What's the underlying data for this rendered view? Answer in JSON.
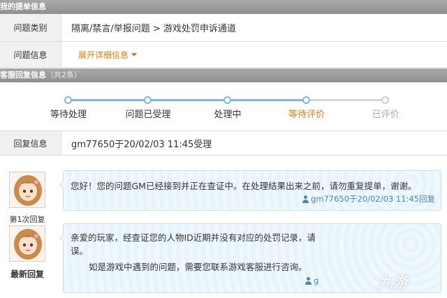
{
  "ticket_section": {
    "title": "我的提单信息"
  },
  "ticket": {
    "category_label": "问题类别",
    "category_value": "隔离/禁言/举报问题 > 游戏处罚申诉通道",
    "info_label": "问题信息",
    "expand_link": "展开详细信息"
  },
  "reply_section": {
    "title": "客服回复信息",
    "count": "（共2条）"
  },
  "progress": {
    "steps": [
      {
        "label": "等待处理",
        "state": "done"
      },
      {
        "label": "问题已受理",
        "state": "done"
      },
      {
        "label": "处理中",
        "state": "done"
      },
      {
        "label": "等待评价",
        "state": "current"
      },
      {
        "label": "已评价",
        "state": "pending"
      }
    ]
  },
  "reply_info": {
    "label": "回复信息",
    "value": "gm77650于20/02/03 11:45受理"
  },
  "messages": [
    {
      "caption": "第1次回复",
      "text": "您好！您的问题GM已经接到并正在查证中。在处理结果出来之前，请勿重复提单，谢谢。",
      "meta": "gm77650于20/02/03 11:45回复"
    },
    {
      "caption": "最新回复",
      "text_line1": "亲爱的玩家，经查证您的人物ID近期并没有对应的处罚记录，请",
      "text_line2": "误。",
      "text_line3": "如是游戏中遇到的问题，需要您联系游戏客服进行咨询。",
      "meta": "g"
    }
  ],
  "watermark": "九游",
  "colors": {
    "accent": "#e07a12",
    "progress": "#7ab8e2",
    "bubble": "#e7f4fb",
    "meta": "#4a86b8"
  }
}
